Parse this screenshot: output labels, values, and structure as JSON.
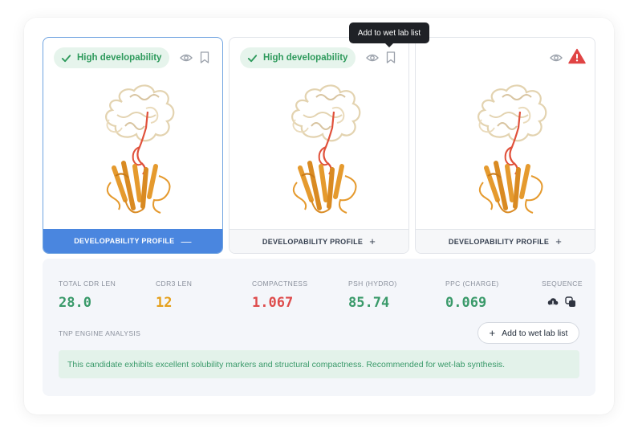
{
  "candidates": [
    {
      "badge": "High developability",
      "profile_label": "DEVELOPABILITY PROFILE",
      "profile_symbol": "—",
      "active": true,
      "status": "good"
    },
    {
      "badge": "High developability",
      "profile_label": "DEVELOPABILITY PROFILE",
      "profile_symbol": "+",
      "active": false,
      "status": "good"
    },
    {
      "badge": "",
      "profile_label": "DEVELOPABILITY PROFILE",
      "profile_symbol": "+",
      "active": false,
      "status": "warning"
    }
  ],
  "tooltip": {
    "text": "Add to wet lab list"
  },
  "stats": [
    {
      "label": "TOTAL CDR LEN",
      "value": "28.0",
      "color": "#3a9a6a"
    },
    {
      "label": "CDR3 LEN",
      "value": "12",
      "color": "#e5a01c"
    },
    {
      "label": "COMPACTNESS",
      "value": "1.067",
      "color": "#de4c4c"
    },
    {
      "label": "PSH (HYDRO)",
      "value": "85.74",
      "color": "#3a9a6a"
    },
    {
      "label": "PPC (CHARGE)",
      "value": "0.069",
      "color": "#3a9a6a"
    }
  ],
  "sequence": {
    "label": "SEQUENCE",
    "icons": [
      "cloud-download-icon",
      "copy-icon"
    ]
  },
  "engine": {
    "label": "TNP ENGINE ANALYSIS",
    "button_label": "Add to wet lab list",
    "analysis_text": "This candidate exhibits excellent solubility markers and structural compactness. Recommended for wet-lab synthesis."
  },
  "colors": {
    "accent_blue": "#4a86df",
    "success_green": "#3a9a6a",
    "warning_orange": "#e5a01c",
    "danger_red": "#de4c4c",
    "protein_beige": "#e9dcc0",
    "protein_orange": "#e59a2e",
    "cdr_red": "#e0503a"
  }
}
